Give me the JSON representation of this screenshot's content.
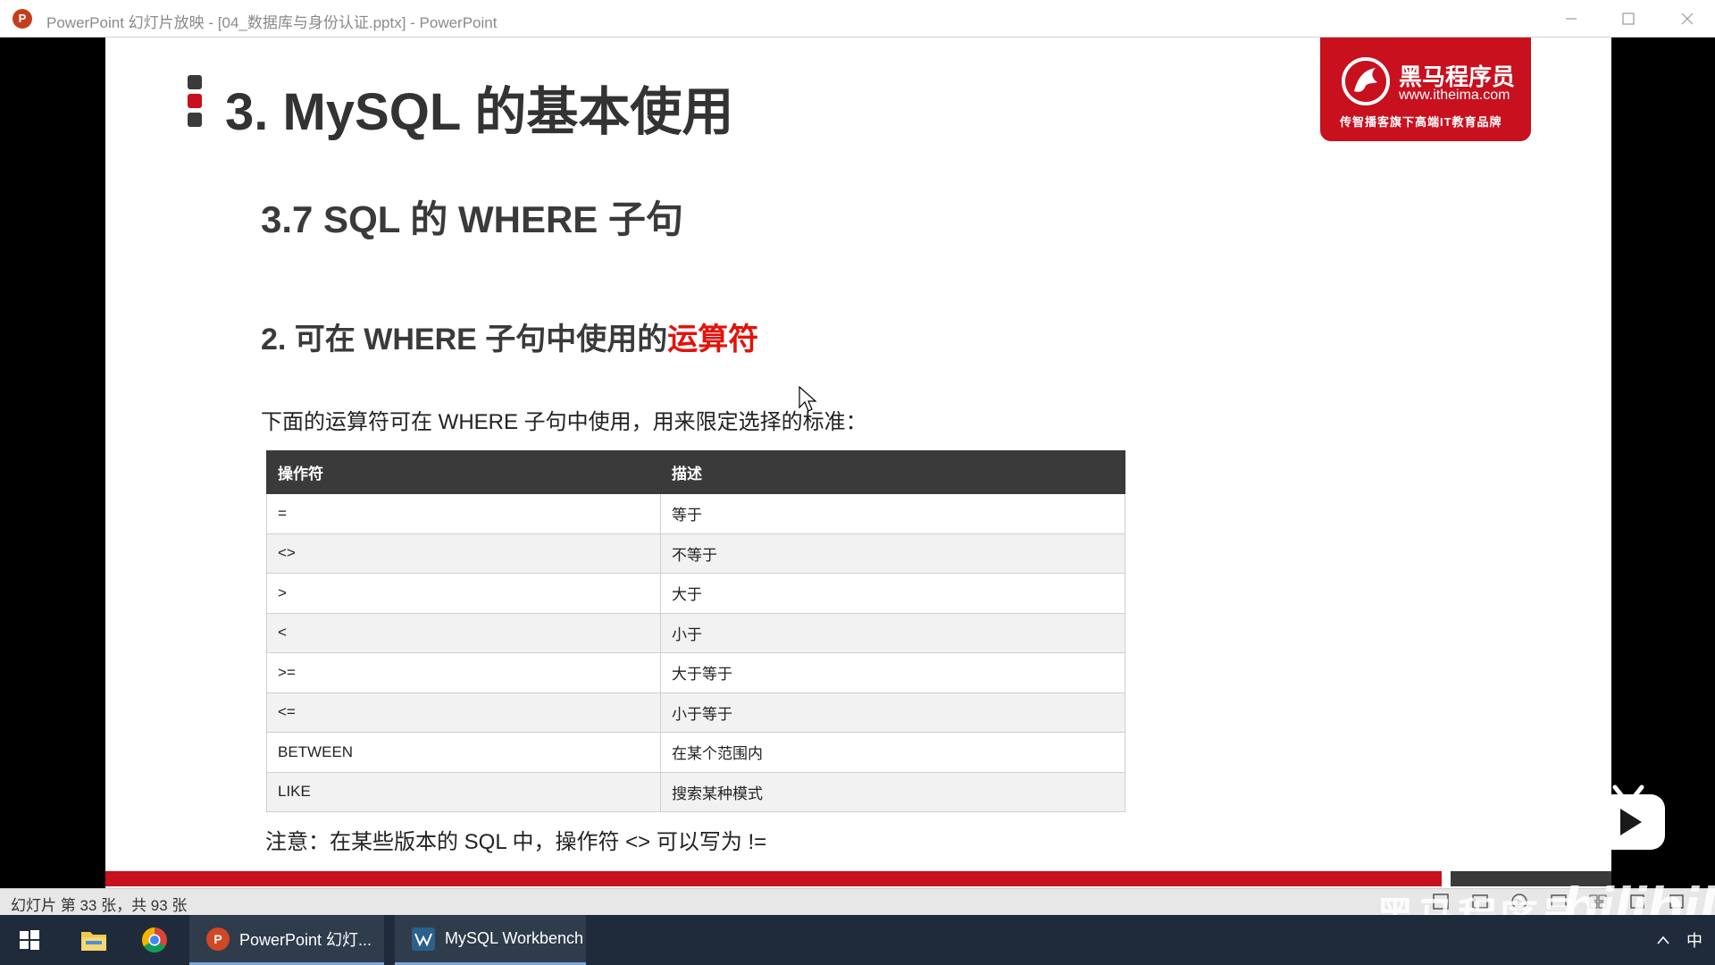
{
  "window": {
    "title": "PowerPoint 幻灯片放映 - [04_数据库与身份认证.pptx] - PowerPoint",
    "app_icon_letter": "P"
  },
  "slide": {
    "title": "3. MySQL 的基本使用",
    "section_heading": "3.7 SQL 的 WHERE 子句",
    "sub_heading_prefix": "2. 可在 WHERE 子句中使用的",
    "sub_heading_accent": "运算符",
    "intro": "下面的运算符可在 WHERE 子句中使用，用来限定选择的标准：",
    "table": {
      "headers": [
        "操作符",
        "描述"
      ],
      "rows": [
        {
          "op": "=",
          "desc": "等于"
        },
        {
          "op": "<>",
          "desc": "不等于"
        },
        {
          "op": ">",
          "desc": "大于"
        },
        {
          "op": "<",
          "desc": "小于"
        },
        {
          "op": ">=",
          "desc": "大于等于"
        },
        {
          "op": "<=",
          "desc": "小于等于"
        },
        {
          "op": "BETWEEN",
          "desc": "在某个范围内"
        },
        {
          "op": "LIKE",
          "desc": "搜索某种模式"
        }
      ]
    },
    "note": "注意：在某些版本的 SQL 中，操作符 <> 可以写为 !=",
    "logo": {
      "name": "黑马程序员",
      "url": "www.itheima.com",
      "slogan": "传智播客旗下高端IT教育品牌"
    }
  },
  "statusbar": {
    "slide_counter": "幻灯片 第 33 张，共 93 张"
  },
  "watermark": {
    "text": "黑马程序员",
    "bili": "bilibili"
  },
  "taskbar": {
    "items": [
      {
        "label": "PowerPoint 幻灯..."
      },
      {
        "label": "MySQL Workbench"
      }
    ],
    "ime": "中"
  },
  "colors": {
    "accent_red": "#e3120b",
    "brand_red": "#c8101e",
    "table_header": "#3a3a3a"
  }
}
